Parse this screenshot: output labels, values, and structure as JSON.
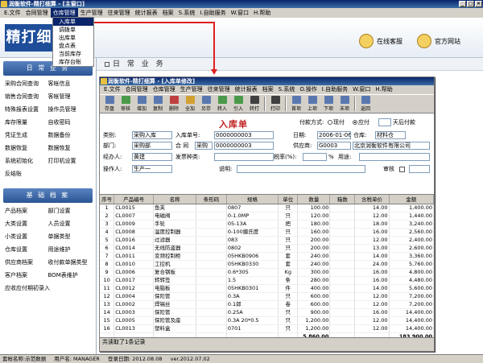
{
  "app": {
    "title": "润衡软件-精打细算 - [主窗口]"
  },
  "menu": [
    "E.文件",
    "合同管理",
    "仓库管理",
    "生产管理",
    "往来管理",
    "统计报表",
    "档案",
    "S.系统",
    "I.自助服务",
    "W.窗口",
    "H.帮助"
  ],
  "dropdown": [
    "入库单",
    "调拨单",
    "出库单",
    "盘点表",
    "当前库存",
    "库存台帐"
  ],
  "banner": {
    "logo": "精打细",
    "service": "在线客服",
    "website": "官方网站"
  },
  "workarea": {
    "heading": "日 常 业 务"
  },
  "sidebar": {
    "daily_title": "日 常 业 务",
    "daily_items": [
      "采购合同查询",
      "客帐信息",
      "销售合同查询",
      "客帐管理",
      "特殊报表设置",
      "操作员管理",
      "库存限量",
      "自收密码",
      "凭证生成",
      "数据备份",
      "数据恢复",
      "数据恢复",
      "系统初始化",
      "打印机设置",
      "反结账"
    ],
    "archive_title": "基 础 档 案",
    "archive_items": [
      "产品档案",
      "部门设置",
      "大类设置",
      "人员设置",
      "小类设置",
      "单据类型",
      "仓库设置",
      "用途维护",
      "供应商档案",
      "收付款单据类型",
      "客户档案",
      "BOM表维护",
      "应收应付期初录入"
    ]
  },
  "inner": {
    "title": "润衡软件-精打细算 - [入库单修改]",
    "menu": [
      "E.文件",
      "合同管理",
      "仓库管理",
      "生产管理",
      "往来管理",
      "统计报表",
      "档案",
      "S.系统",
      "O.操作",
      "I.自助服务",
      "W.窗口",
      "H.帮助"
    ],
    "toolbar": [
      "存盘",
      "审核",
      "增加",
      "复制",
      "删除",
      "全加",
      "另存",
      "转入",
      "引入",
      "转打",
      "打印",
      "首项",
      "上项",
      "下项",
      "末项",
      "返回"
    ],
    "status": "共读取了1条记录"
  },
  "form": {
    "title": "入库单",
    "pay_method_label": "付款方式:",
    "pay_cash": "现付",
    "pay_credit": "应付",
    "pay_days_suffix": "天后付款",
    "type_label": "类别:",
    "type_value": "采购入库",
    "no_label": "入库单号:",
    "no_value": "0000000003",
    "date_label": "日期:",
    "date_value": "2006-01-06",
    "warehouse_label": "仓库:",
    "warehouse_value": "材料仓",
    "dept_label": "部门:",
    "dept_value": "采购部",
    "contract_label": "合 同",
    "contract_prefix": "采购",
    "contract_value": "0000000003",
    "supplier_label": "供应商:",
    "supplier_code": "G0003",
    "supplier_name": "北京润衡软件有限公司",
    "handler_label": "经办人:",
    "handler_value": "黄建",
    "invoice_label": "发票种类:",
    "tax_label": "税率(%):",
    "tax_unit": "%",
    "use_label": "用途:",
    "operator_label": "操作人:",
    "operator_value": "生产一",
    "remark_label": "说明:",
    "audit_label": "审核"
  },
  "table": {
    "headers": [
      "序号",
      "产品编号",
      "名称",
      "条形码",
      "规格",
      "单位",
      "数量",
      "箱数",
      "含税单价",
      "金额"
    ],
    "rows": [
      [
        "1",
        "CL0015",
        "鱼夹",
        "",
        "0807",
        "只",
        "100.00",
        "",
        "14.00",
        "1,400.00"
      ],
      [
        "2",
        "CL0007",
        "电磁阀",
        "",
        "0-1.0MP",
        "只",
        "120.00",
        "",
        "12.00",
        "1,440.00"
      ],
      [
        "3",
        "CL0009",
        "手轮",
        "",
        "05-13A",
        "把",
        "180.00",
        "",
        "18.00",
        "3,240.00"
      ],
      [
        "4",
        "CL0008",
        "温度控制器",
        "",
        "0-100摄氏度",
        "只",
        "160.00",
        "",
        "16.00",
        "2,560.00"
      ],
      [
        "5",
        "CL0016",
        "过滤器",
        "",
        "083",
        "只",
        "200.00",
        "",
        "12.00",
        "2,400.00"
      ],
      [
        "6",
        "CL0014",
        "无线防盗器",
        "",
        "0802",
        "只",
        "200.00",
        "",
        "13.00",
        "2,600.00"
      ],
      [
        "7",
        "CL0011",
        "变频控制柜",
        "",
        "05HKB0906",
        "套",
        "240.00",
        "",
        "14.00",
        "3,360.00"
      ],
      [
        "8",
        "CL0010",
        "工控机",
        "",
        "05HKB0330",
        "套",
        "240.00",
        "",
        "24.00",
        "5,760.00"
      ],
      [
        "9",
        "CL0006",
        "复合钢板",
        "",
        "0.6*305",
        "Kg",
        "300.00",
        "",
        "16.00",
        "4,800.00"
      ],
      [
        "10",
        "CL0017",
        "转转签",
        "",
        "1.5",
        "条",
        "280.00",
        "",
        "16.00",
        "4,480.00"
      ],
      [
        "11",
        "CL0012",
        "电脑板",
        "",
        "05HKB0301",
        "件",
        "400.00",
        "",
        "14.00",
        "5,600.00"
      ],
      [
        "12",
        "CL0004",
        "保险管",
        "",
        "0.3A",
        "只",
        "600.00",
        "",
        "12.00",
        "7,200.00"
      ],
      [
        "13",
        "CL0002",
        "焊锡丝",
        "",
        "0.1郎",
        "卷",
        "600.00",
        "",
        "12.00",
        "7,200.00"
      ],
      [
        "14",
        "CL0003",
        "保险管",
        "",
        "0.25A",
        "只",
        "900.00",
        "",
        "16.00",
        "14,400.00"
      ],
      [
        "15",
        "CL0005",
        "保险管及座",
        "",
        "0.3A 20*0.5",
        "只",
        "1,200.00",
        "",
        "12.00",
        "14,400.00"
      ],
      [
        "16",
        "CL0013",
        "塑料盒",
        "",
        "0701",
        "只",
        "1,200.00",
        "",
        "12.00",
        "14,400.00"
      ]
    ],
    "total_qty": "5,860.00",
    "total_amount": "183,900.00"
  },
  "statusbar": {
    "account": "套帐名称:示范数据",
    "user": "用户名: MANAGER",
    "login": "登录日期: 2012.08.08",
    "version": "ver.2012.07.02"
  }
}
